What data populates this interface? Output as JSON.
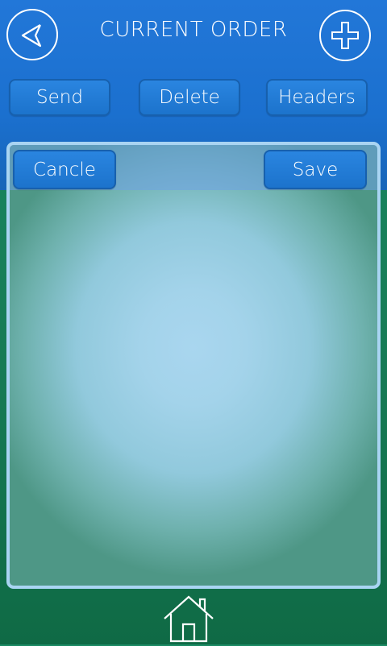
{
  "header": {
    "title": "CURRENT ORDER",
    "back_icon": "back-arrow-icon",
    "add_icon": "plus-icon"
  },
  "toolbar": {
    "send_label": "Send",
    "delete_label": "Delete",
    "headers_label": "Headers"
  },
  "panel": {
    "cancel_label": "Cancle",
    "save_label": "Save"
  },
  "footer": {
    "home_icon": "home-icon"
  },
  "colors": {
    "header_blue": "#1b70cf",
    "button_blue": "#1c73cc",
    "background_green": "#167a55",
    "panel_border": "#a9d4f2"
  }
}
